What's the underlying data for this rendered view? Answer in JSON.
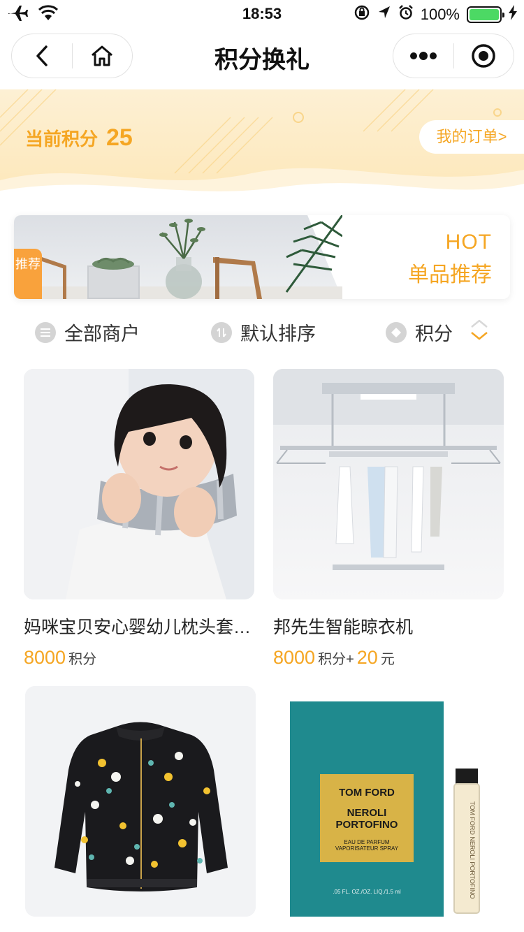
{
  "status_bar": {
    "time": "18:53",
    "battery": "100%"
  },
  "nav": {
    "title": "积分换礼"
  },
  "points": {
    "label": "当前积分",
    "value": "25",
    "orders_label": "我的订单>"
  },
  "hot": {
    "tag": "推荐",
    "line1": "HOT",
    "line2": "单品推荐"
  },
  "filters": [
    {
      "label": "全部商户",
      "icon": "list-icon"
    },
    {
      "label": "默认排序",
      "icon": "sort-icon"
    },
    {
      "label": "积分",
      "icon": "diamond-icon"
    }
  ],
  "products": [
    {
      "name": "妈咪宝贝安心婴幼儿枕头套…",
      "points": "8000",
      "points_unit": "积分",
      "plus": "",
      "cash": "",
      "cash_unit": ""
    },
    {
      "name": "邦先生智能晾衣机",
      "points": "8000",
      "points_unit": "积分+",
      "plus": "",
      "cash": "20",
      "cash_unit": "元"
    },
    {
      "name": "",
      "points": "",
      "points_unit": "",
      "cash": "",
      "cash_unit": ""
    },
    {
      "name": "",
      "points": "",
      "points_unit": "",
      "cash": "",
      "cash_unit": ""
    }
  ],
  "perfume_box": {
    "brand": "TOM FORD",
    "name1": "NEROLI",
    "name2": "PORTOFINO",
    "sub1": "EAU DE PARFUM",
    "sub2": "VAPORISATEUR SPRAY",
    "size": ".05 FL. OZ./OZ. LIQ./1.5 ml",
    "vial": "TOM FORD NEROLI PORTOFINO"
  },
  "colors": {
    "accent": "#f5a623",
    "banner": "#fde7b8"
  }
}
